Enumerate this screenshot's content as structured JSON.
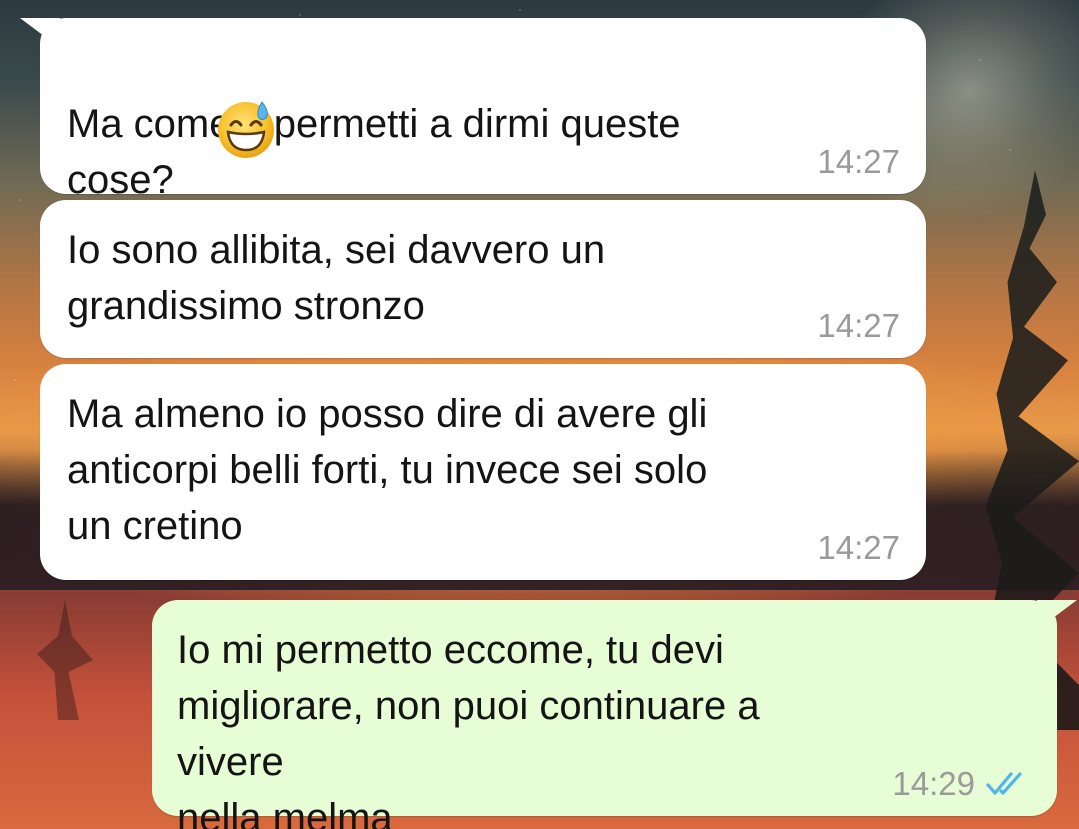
{
  "chat": {
    "messages": [
      {
        "direction": "incoming",
        "text": "Ma come ti permetti a dirmi queste\ncose?",
        "emoji": "grinning-face-with-sweat-icon",
        "time": "14:27"
      },
      {
        "direction": "incoming",
        "text": "Io sono allibita, sei davvero un\ngrandissimo stronzo",
        "time": "14:27"
      },
      {
        "direction": "incoming",
        "text": "Ma almeno io posso dire di avere gli\nanticorpi belli forti, tu invece sei solo\nun cretino",
        "time": "14:27"
      },
      {
        "direction": "outgoing",
        "text": "Io mi permetto eccome, tu devi\nmigliorare, non puoi continuare a vivere\nnella melma",
        "time": "14:29",
        "status_icon": "double-check-read-icon"
      }
    ]
  },
  "colors": {
    "incoming_bubble": "#ffffff",
    "outgoing_bubble": "#e7fdd6",
    "timestamp": "#9a9a9a",
    "read_ticks": "#4fb6ec"
  }
}
